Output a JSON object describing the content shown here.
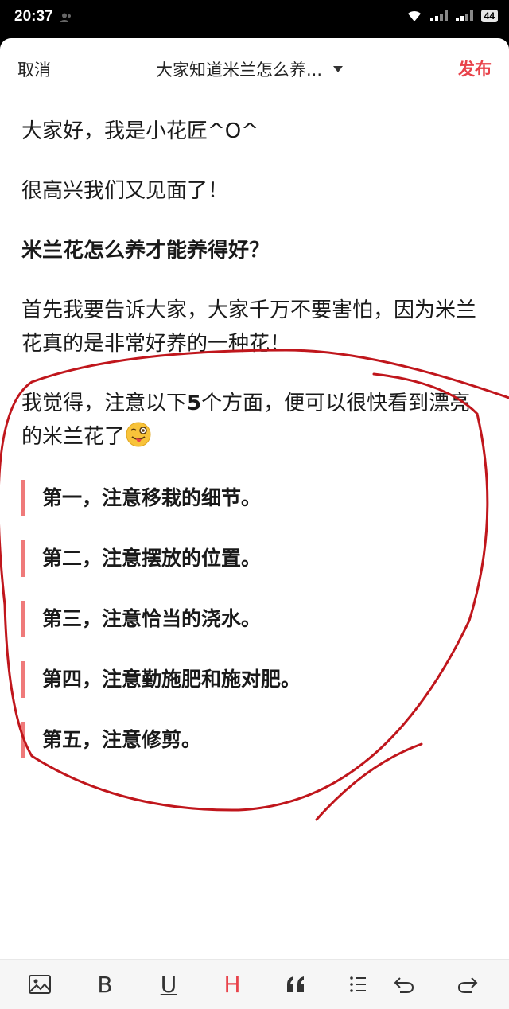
{
  "status": {
    "time": "20:37",
    "battery": "44"
  },
  "header": {
    "cancel": "取消",
    "title": "大家知道米兰怎么养...",
    "publish": "发布"
  },
  "content": {
    "p1": "大家好，我是小花匠^O^",
    "p2": "很高兴我们又见面了！",
    "heading": "米兰花怎么养才能养得好？",
    "p3": "首先我要告诉大家，大家千万不要害怕，因为米兰花真的是非常好养的一种花！",
    "p4_a": "我觉得，注意以下",
    "p4_num": "5",
    "p4_b": "个方面，便可以很快看到漂亮的米兰花了",
    "points": [
      "第一，注意移栽的细节。",
      "第二，注意摆放的位置。",
      "第三，注意恰当的浇水。",
      "第四，注意勤施肥和施对肥。",
      "第五，注意修剪。"
    ]
  },
  "toolbar": {
    "bold": "B",
    "underline": "U",
    "heading": "H"
  },
  "colors": {
    "accent": "#e8424a",
    "quote_bar": "#ef7a7a",
    "annotation": "#c0161c"
  }
}
